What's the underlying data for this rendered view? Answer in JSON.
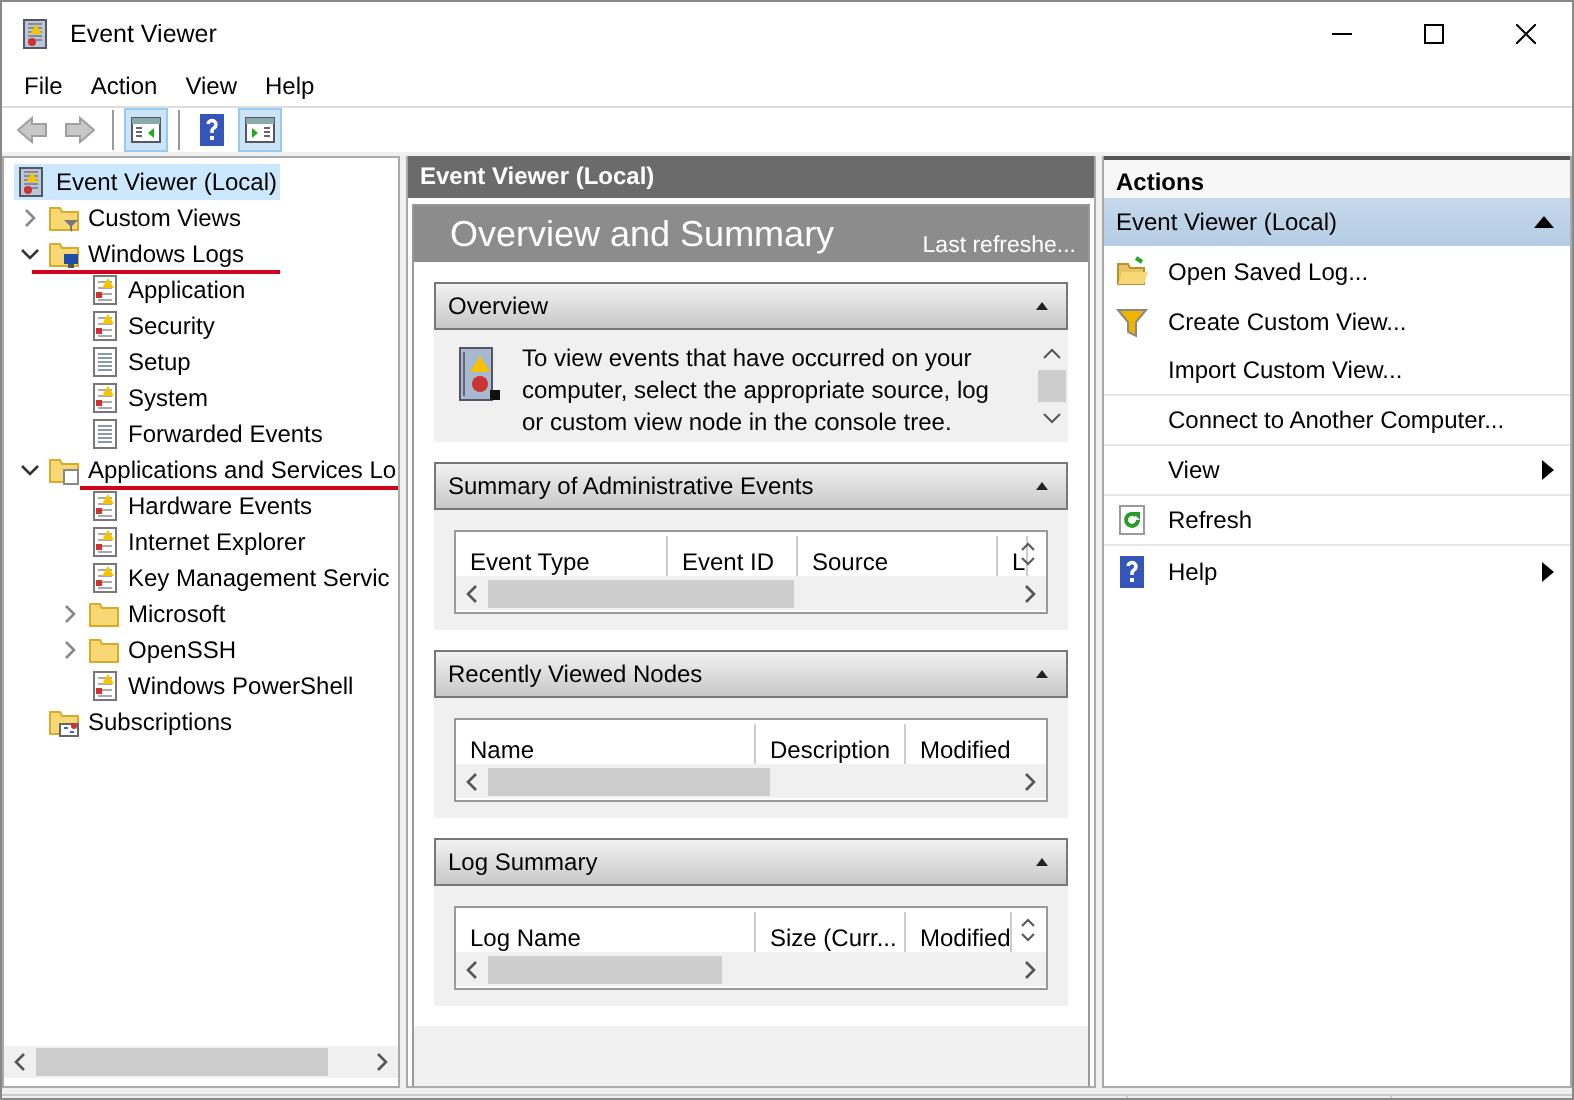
{
  "window": {
    "title": "Event Viewer"
  },
  "menu": [
    "File",
    "Action",
    "View",
    "Help"
  ],
  "toolbar": [
    {
      "kind": "back",
      "disabled": true,
      "pressed": false
    },
    {
      "kind": "forward",
      "disabled": true,
      "pressed": false
    },
    {
      "kind": "separator"
    },
    {
      "kind": "tree-toggle",
      "disabled": false,
      "pressed": true
    },
    {
      "kind": "separator"
    },
    {
      "kind": "help",
      "disabled": false,
      "pressed": false
    },
    {
      "kind": "action-toggle",
      "disabled": false,
      "pressed": true
    }
  ],
  "tree": [
    {
      "label": "Event Viewer (Local)",
      "kind": "root",
      "selected": true,
      "children": [
        {
          "label": "Custom Views",
          "kind": "folder-filter",
          "selected": false,
          "expanded": false
        },
        {
          "label": "Windows Logs",
          "kind": "folder-log",
          "selected": false,
          "expanded": true,
          "underlined": true,
          "children": [
            {
              "label": "Application",
              "kind": "log",
              "selected": false
            },
            {
              "label": "Security",
              "kind": "log",
              "selected": false
            },
            {
              "label": "Setup",
              "kind": "plain-log",
              "selected": false
            },
            {
              "label": "System",
              "kind": "log",
              "selected": false
            },
            {
              "label": "Forwarded Events",
              "kind": "plain-log",
              "selected": false
            }
          ]
        },
        {
          "label": "Applications and Services Lo",
          "kind": "folder-doc",
          "selected": false,
          "expanded": true,
          "underlined": true,
          "children": [
            {
              "label": "Hardware Events",
              "kind": "log",
              "selected": false
            },
            {
              "label": "Internet Explorer",
              "kind": "log",
              "selected": false
            },
            {
              "label": "Key Management Servic",
              "kind": "log",
              "selected": false
            },
            {
              "label": "Microsoft",
              "kind": "folder",
              "selected": false,
              "expanded": false
            },
            {
              "label": "OpenSSH",
              "kind": "folder",
              "selected": false,
              "expanded": false
            },
            {
              "label": "Windows PowerShell",
              "kind": "log",
              "selected": false
            }
          ]
        },
        {
          "label": "Subscriptions",
          "kind": "folder-sub",
          "selected": false
        }
      ]
    }
  ],
  "center": {
    "header": "Event Viewer (Local)",
    "title": "Overview and Summary",
    "refresh_note": "Last refreshe...",
    "sections": [
      {
        "kind": "text",
        "title": "Overview",
        "expanded": true,
        "text": "To view events that have occurred on your computer, select the appropriate source, log or custom view node in the console tree."
      },
      {
        "kind": "table",
        "title": "Summary of Administrative Events",
        "expanded": true,
        "columns": [
          "Event Type",
          "Event ID",
          "Source",
          "L"
        ]
      },
      {
        "kind": "table",
        "title": "Recently Viewed Nodes",
        "expanded": true,
        "columns": [
          "Name",
          "Description",
          "Modified"
        ]
      },
      {
        "kind": "table",
        "title": "Log Summary",
        "expanded": true,
        "columns": [
          "Log Name",
          "Size (Curr...",
          "Modified"
        ]
      }
    ]
  },
  "actions": {
    "title": "Actions",
    "group": {
      "label": "Event Viewer (Local)",
      "expanded": true
    },
    "items": [
      {
        "label": "Open Saved Log...",
        "kind": "open-folder",
        "submenu": false,
        "divider_below": false
      },
      {
        "label": "Create Custom View...",
        "kind": "filter",
        "submenu": false,
        "divider_below": false
      },
      {
        "label": "Import Custom View...",
        "submenu": false,
        "divider_below": true
      },
      {
        "label": "Connect to Another Computer...",
        "submenu": false,
        "divider_below": true
      },
      {
        "label": "View",
        "submenu": true,
        "divider_below": true
      },
      {
        "label": "Refresh",
        "kind": "refresh",
        "submenu": false,
        "divider_below": true
      },
      {
        "label": "Help",
        "kind": "help",
        "submenu": true,
        "divider_below": false
      }
    ]
  }
}
